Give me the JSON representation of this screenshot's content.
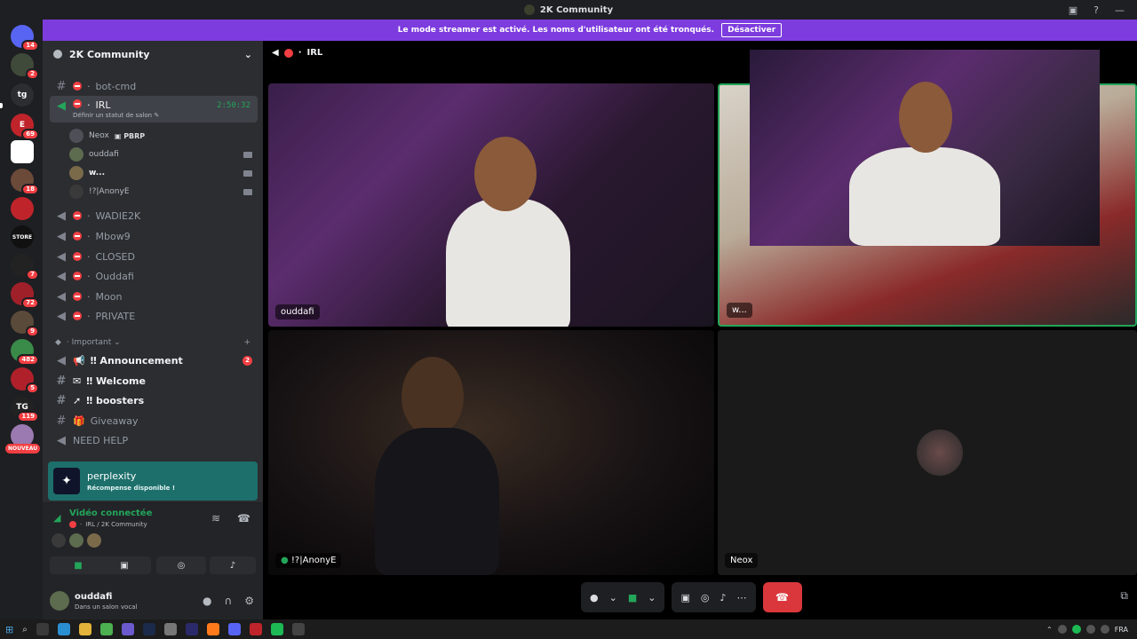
{
  "app": {
    "title": "2K Community",
    "streamer_banner": "Le mode streamer est activé. Les noms d'utilisateur ont été tronqués.",
    "streamer_button": "Désactiver"
  },
  "servers": [
    {
      "label": "",
      "badge": "14",
      "color": "#5865f2"
    },
    {
      "label": "",
      "badge": "2",
      "color": "#3f4a3a"
    },
    {
      "label": "tg",
      "badge": "",
      "color": "#2b2d31"
    },
    {
      "label": "E",
      "badge": "69",
      "color": "#c0242b"
    },
    {
      "label": "",
      "badge": "",
      "color": "#ffffff"
    },
    {
      "label": "",
      "badge": "18",
      "color": "#6b4a3a"
    },
    {
      "label": "",
      "badge": "",
      "color": "#c0242b"
    },
    {
      "label": "STORE",
      "badge": "",
      "color": "#111111"
    },
    {
      "label": "",
      "badge": "7",
      "color": "#222222"
    },
    {
      "label": "",
      "badge": "72",
      "color": "#a0202a"
    },
    {
      "label": "",
      "badge": "9",
      "color": "#5a4a3a"
    },
    {
      "label": "",
      "badge": "482",
      "color": "#3a8a4a"
    },
    {
      "label": "",
      "badge": "5",
      "color": "#b0202a"
    },
    {
      "label": "TG",
      "badge": "119",
      "color": "#222222"
    },
    {
      "label": "",
      "badge": "",
      "color": "#9a7ab0"
    }
  ],
  "nouveau_label": "NOUVEAU",
  "sidebar": {
    "guild_name": "2K Community",
    "channels": [
      {
        "name": "bot-cmd",
        "prefix": "·"
      },
      {
        "name": "IRL",
        "prefix": "·",
        "timer": "2:50:32",
        "status": "Définir un statut de salon"
      },
      {
        "name": "WADIE2K",
        "prefix": "·"
      },
      {
        "name": "Mbow9",
        "prefix": "·"
      },
      {
        "name": "CLOSED",
        "prefix": "·"
      },
      {
        "name": "Ouddafi",
        "prefix": "·"
      },
      {
        "name": "Moon",
        "prefix": "·"
      },
      {
        "name": "PRIVATE",
        "prefix": "·"
      }
    ],
    "members": [
      {
        "name": "Neox",
        "tag": "PBRP"
      },
      {
        "name": "ouddafi"
      },
      {
        "name": "w..."
      },
      {
        "name": "!?|AnonyE"
      }
    ],
    "category": "Important",
    "important_channels": [
      {
        "name": "‼ Announcement",
        "mention": "2"
      },
      {
        "name": "‼ Welcome"
      },
      {
        "name": "‼ boosters"
      },
      {
        "name": "Giveaway"
      },
      {
        "name": "NEED HELP"
      }
    ]
  },
  "promo": {
    "title": "perplexity",
    "subtitle": "Récompense disponible !"
  },
  "voice": {
    "status": "Vidéo connectée",
    "location": "IRL / 2K Community"
  },
  "user": {
    "name": "ouddafi",
    "status": "Dans un salon vocal"
  },
  "main": {
    "channel_title": "IRL",
    "tiles": [
      {
        "label": "ouddafi"
      },
      {
        "label": "w..."
      },
      {
        "label": "!?|AnonyE"
      },
      {
        "label": "Neox"
      }
    ]
  },
  "taskbar": {
    "language": "FRA"
  },
  "colors": {
    "accent": "#7d3cde",
    "online": "#23a55a",
    "danger": "#da373c",
    "promo": "#1d6f6b"
  }
}
